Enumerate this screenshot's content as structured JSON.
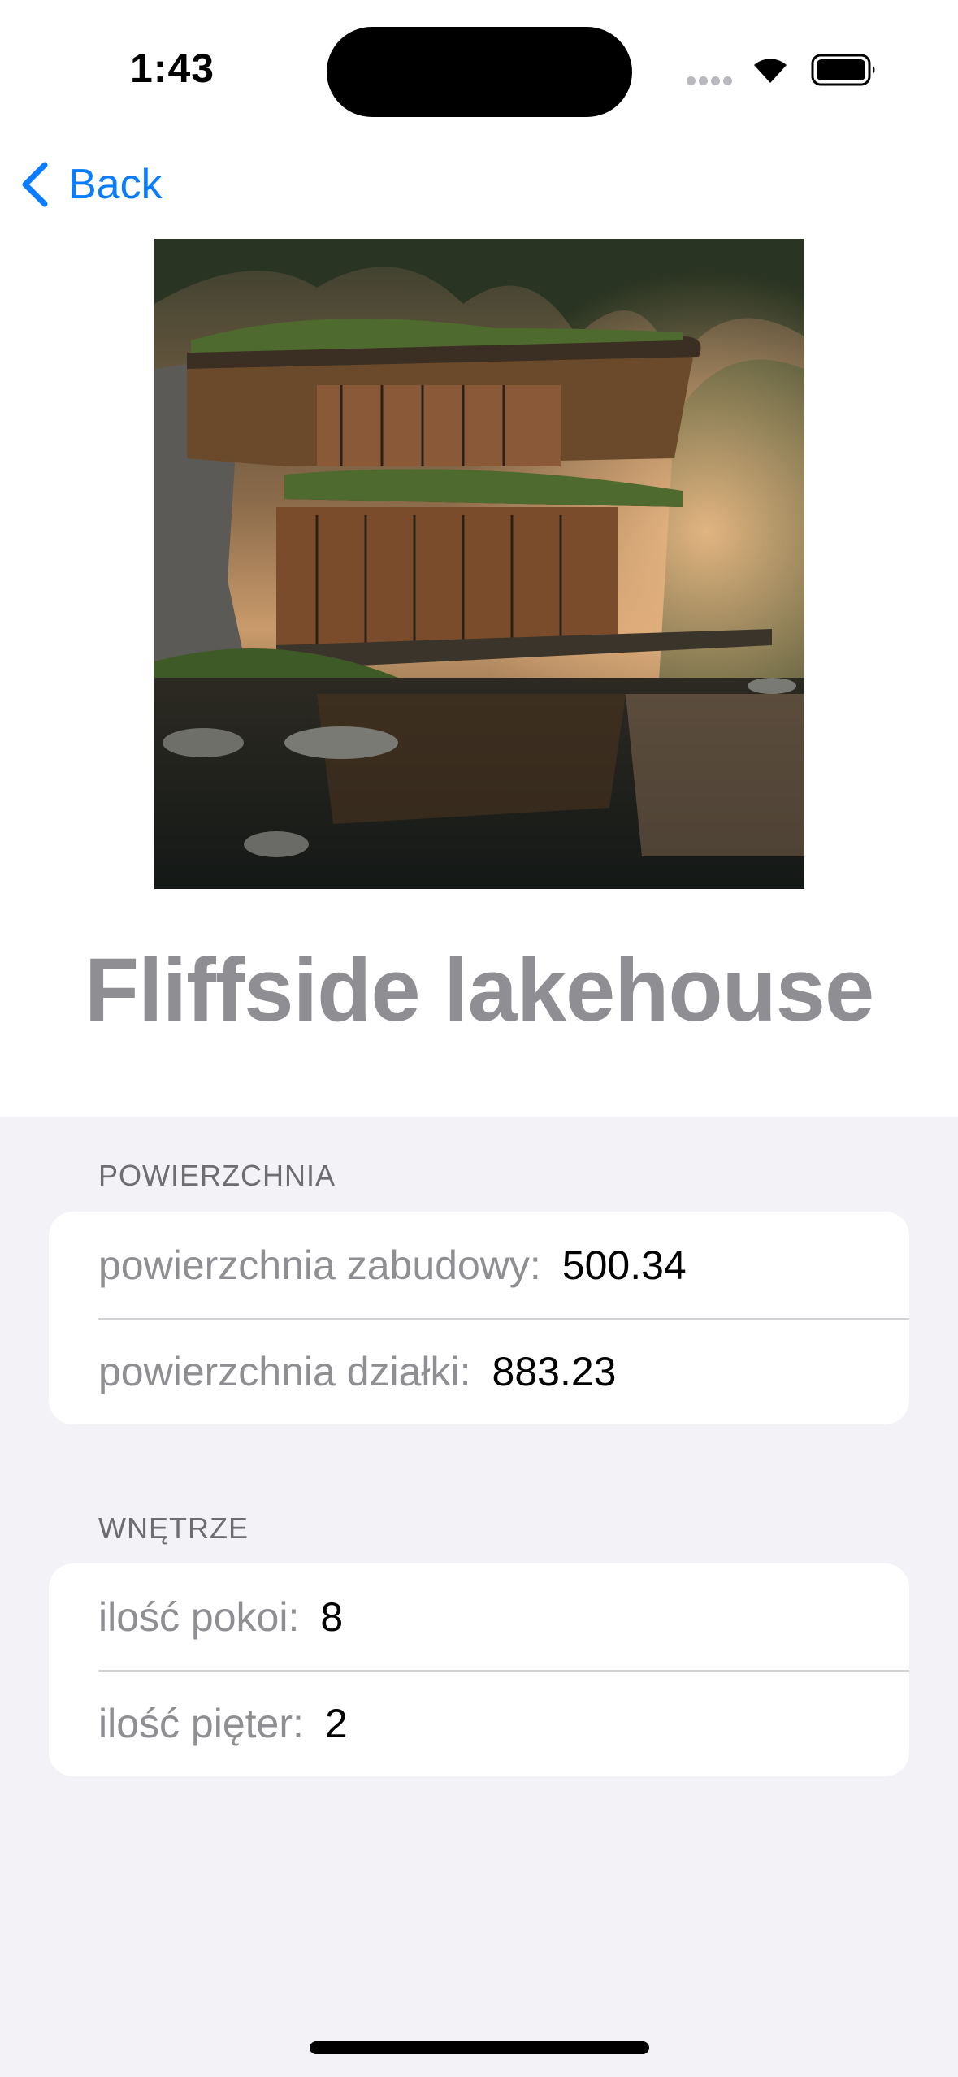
{
  "status_bar": {
    "time": "1:43"
  },
  "nav": {
    "back_label": "Back"
  },
  "property": {
    "title": "Fliffside lakehouse"
  },
  "sections": [
    {
      "header": "POWIERZCHNIA",
      "rows": [
        {
          "label": "powierzchnia zabudowy:",
          "value": "500.34"
        },
        {
          "label": "powierzchnia działki:",
          "value": "883.23"
        }
      ]
    },
    {
      "header": "WNĘTRZE",
      "rows": [
        {
          "label": "ilość pokoi:",
          "value": "8"
        },
        {
          "label": "ilość pięter:",
          "value": "2"
        }
      ]
    }
  ],
  "colors": {
    "accent": "#0a7cff",
    "grouped_background": "#f2f2f7",
    "secondary_label": "#8e8e93"
  }
}
